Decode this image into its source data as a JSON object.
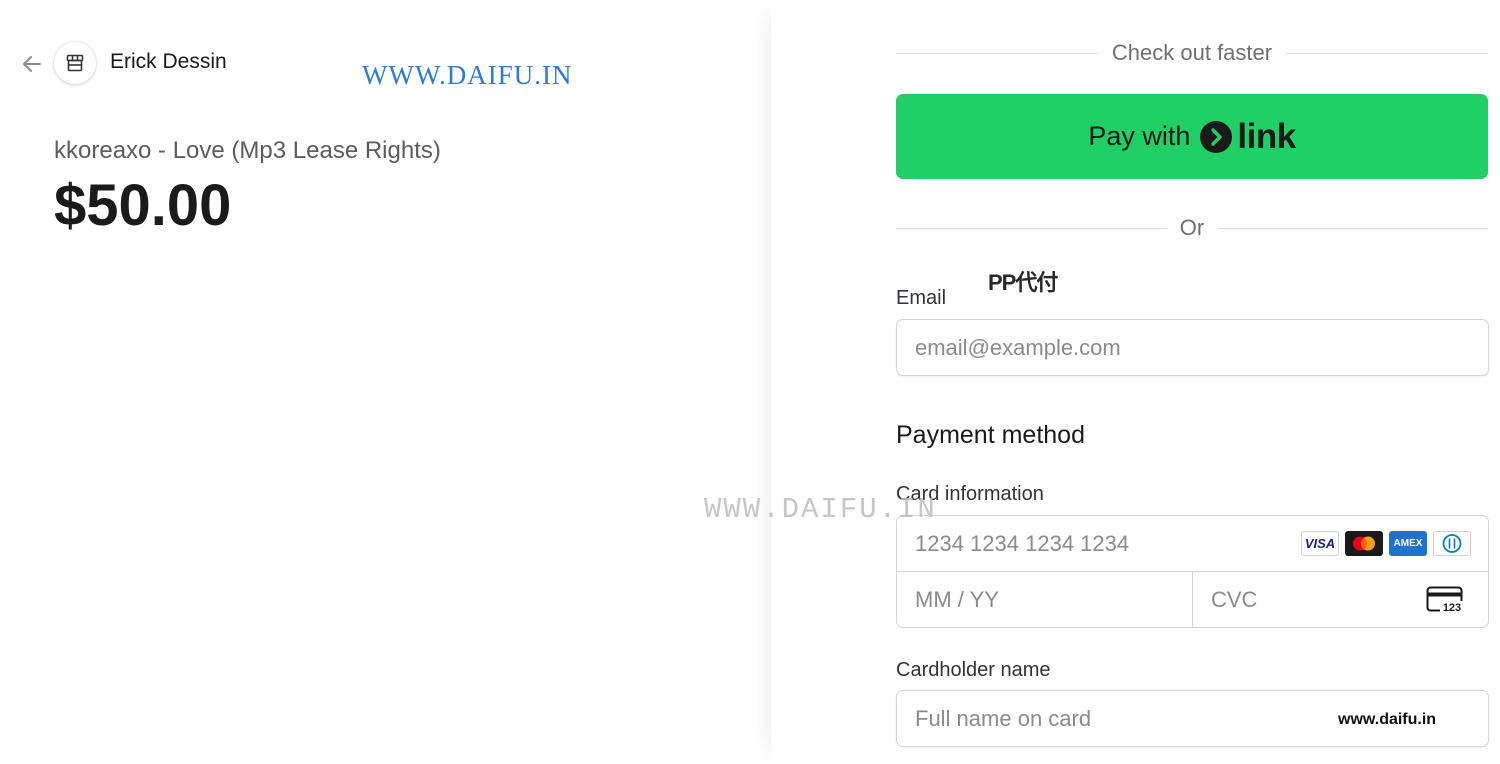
{
  "merchant": {
    "name": "Erick Dessin",
    "back_icon": "arrow-left-icon",
    "logo_icon": "store-icon"
  },
  "product": {
    "name": "kkoreaxo - Love (Mp3 Lease Rights)",
    "price": "$50.00"
  },
  "checkout": {
    "faster_label": "Check out faster",
    "link_button": {
      "prefix": "Pay with",
      "brand": "link"
    },
    "or_label": "Or",
    "email_label": "Email",
    "email_placeholder": "email@example.com",
    "payment_title": "Payment method",
    "card_info_label": "Card information",
    "card_number_placeholder": "1234 1234 1234 1234",
    "expiry_placeholder": "MM / YY",
    "cvc_placeholder": "CVC",
    "cvc_icon_text": "123",
    "card_brands": [
      "VISA",
      "Mastercard",
      "AMEX",
      "Diners"
    ],
    "cardholder_label": "Cardholder name",
    "cardholder_placeholder": "Full name on card"
  },
  "watermarks": {
    "top": "WWW.DAIFU.IN",
    "middle": "WWW.DAIFU.IN",
    "chinese": "PP代付",
    "bottom": "www.daifu.in"
  },
  "colors": {
    "link_green": "#20cf66",
    "amex_blue": "#1f72cd",
    "watermark_blue": "#2e7bd1"
  }
}
